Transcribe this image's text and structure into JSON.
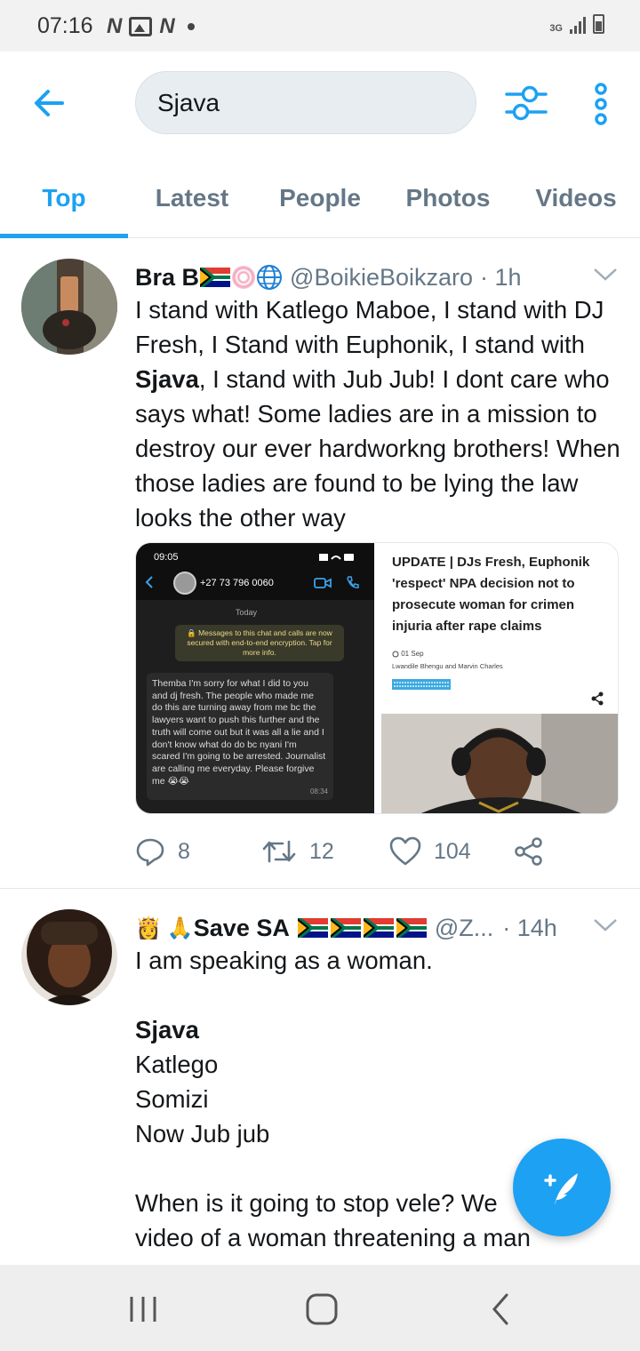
{
  "status_bar": {
    "time": "07:16",
    "network": "3G"
  },
  "search": {
    "query": "Sjava"
  },
  "tabs": [
    {
      "label": "Top",
      "active": true
    },
    {
      "label": "Latest",
      "active": false
    },
    {
      "label": "People",
      "active": false
    },
    {
      "label": "Photos",
      "active": false
    },
    {
      "label": "Videos",
      "active": false
    }
  ],
  "tweets": [
    {
      "name": "Bra B",
      "handle": "@BoikieBoikzaro",
      "time": "· 1h",
      "text_before": "I stand with Katlego Maboe, I stand with DJ Fresh, I Stand with Euphonik, I stand with ",
      "text_bold": "Sjava",
      "text_after": ", I stand with Jub Jub! I dont care who says what! Some ladies are in a mission to destroy our ever hardworkng brothers! When those ladies are found to be lying the law looks the other way",
      "media": {
        "chat": {
          "time": "09:05",
          "contact": "+27 73 796 0060",
          "day": "Today",
          "notice": "🔒 Messages to this chat and calls are now secured with end-to-end encryption. Tap for more info.",
          "message": "Themba I'm sorry for what I did to you and dj fresh. The people who made me do this are turning away from me bc the lawyers want to push this further and the truth will come out but it was all a lie and I don't know what do do bc nyani I'm scared I'm going to be arrested. Journalist are calling me everyday. Please forgive me 😭😭",
          "message_time": "08:34"
        },
        "news": {
          "title": "UPDATE | DJs Fresh, Euphonik 'respect' NPA decision not to prosecute woman for crimen injuria after rape claims",
          "date": "01 Sep",
          "authors": "Lwandile Bhengu and Marvin Charles"
        }
      },
      "replies": "8",
      "retweets": "12",
      "likes": "104"
    },
    {
      "name": "Save SA",
      "handle": "@Z...",
      "time": "· 14h",
      "lines": [
        "I am speaking as a woman.",
        "",
        "Sjava",
        "Katlego",
        "Somizi",
        "Now Jub jub",
        "",
        "When is it going to stop vele? We",
        "video of a woman threatening a man"
      ]
    }
  ],
  "colors": {
    "accent": "#1da1f2",
    "secondary_text": "#657786",
    "divider": "#e1e8ed"
  },
  "icons": [
    "back-arrow-icon",
    "filter-icon",
    "more-vert-icon",
    "reply-icon",
    "retweet-icon",
    "like-icon",
    "share-icon",
    "compose-icon",
    "recents-icon",
    "home-icon",
    "back-nav-icon",
    "chevron-down-icon"
  ]
}
